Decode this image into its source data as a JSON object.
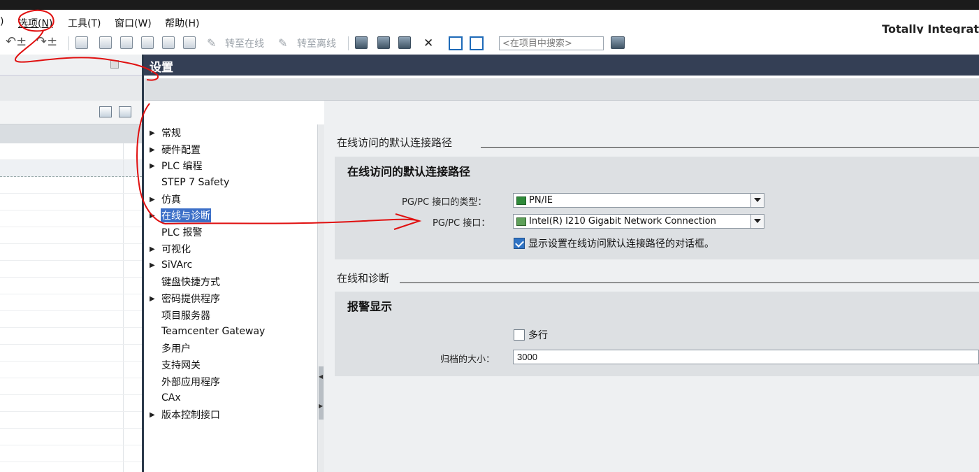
{
  "menubar": {
    "items": [
      {
        "label": ")"
      },
      {
        "label": "选项(N)"
      },
      {
        "label": "工具(T)"
      },
      {
        "label": "窗口(W)"
      },
      {
        "label": "帮助(H)"
      }
    ],
    "app_title": "Totally Integrat"
  },
  "toolbar": {
    "go_online": "转至在线",
    "go_offline": "转至离线",
    "search_placeholder": "<在项目中搜索>"
  },
  "header": {
    "title": "设置"
  },
  "nav": {
    "items": [
      {
        "label": "常规",
        "expandable": true
      },
      {
        "label": "硬件配置",
        "expandable": true
      },
      {
        "label": "PLC 编程",
        "expandable": true
      },
      {
        "label": "STEP 7 Safety",
        "expandable": false
      },
      {
        "label": "仿真",
        "expandable": true
      },
      {
        "label": "在线与诊断",
        "expandable": true,
        "selected": true
      },
      {
        "label": "PLC 报警",
        "expandable": false
      },
      {
        "label": "可视化",
        "expandable": true
      },
      {
        "label": "SiVArc",
        "expandable": true
      },
      {
        "label": "键盘快捷方式",
        "expandable": false
      },
      {
        "label": "密码提供程序",
        "expandable": true
      },
      {
        "label": "项目服务器",
        "expandable": false
      },
      {
        "label": "Teamcenter Gateway",
        "expandable": false
      },
      {
        "label": "多用户",
        "expandable": false
      },
      {
        "label": "支持网关",
        "expandable": false
      },
      {
        "label": "外部应用程序",
        "expandable": false
      },
      {
        "label": "CAx",
        "expandable": false
      },
      {
        "label": "版本控制接口",
        "expandable": true
      }
    ]
  },
  "content": {
    "section1_title": "在线访问的默认连接路径",
    "group1_title": "在线访问的默认连接路径",
    "pgpc_type_label": "PG/PC 接口的类型：",
    "pgpc_type_value": "PN/IE",
    "pgpc_iface_label": "PG/PC 接口：",
    "pgpc_iface_value": "Intel(R) I210 Gigabit Network Connection",
    "show_dialog_label": "显示设置在线访问默认连接路径的对话框。",
    "show_dialog_checked": true,
    "section2_title": "在线和诊断",
    "group2_title": "报警显示",
    "multiline_label": "多行",
    "multiline_checked": false,
    "archive_size_label": "归档的大小：",
    "archive_size_value": "3000"
  },
  "colors": {
    "header_bg": "#343f55",
    "selection": "#3d70c8",
    "annotation": "#e01010"
  }
}
